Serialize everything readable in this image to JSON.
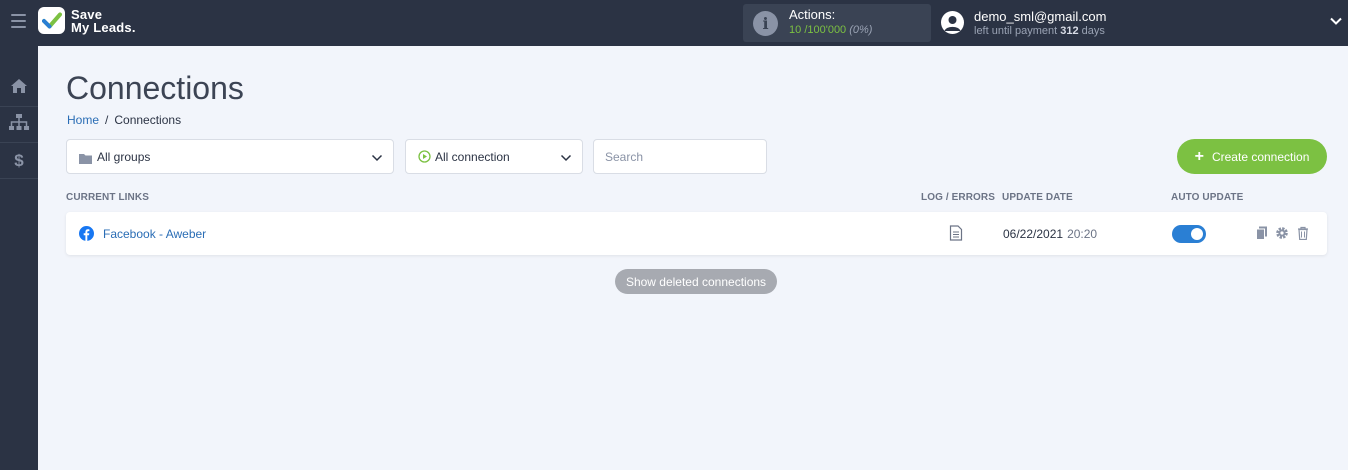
{
  "brand": {
    "line1": "Save",
    "line2": "My Leads."
  },
  "actions": {
    "label": "Actions:",
    "used": "10",
    "total": "/100'000",
    "percent": "(0%)"
  },
  "user": {
    "email": "demo_sml@gmail.com",
    "payment_prefix": "left until payment",
    "days": "312",
    "days_suffix": "days"
  },
  "sidebar": {
    "items": [
      {
        "icon": "home-icon"
      },
      {
        "icon": "sitemap-icon"
      },
      {
        "icon": "dollar-icon"
      }
    ]
  },
  "page": {
    "title": "Connections"
  },
  "breadcrumb": {
    "home": "Home",
    "separator": "/",
    "current": "Connections"
  },
  "filters": {
    "groups": "All groups",
    "connection": "All connection",
    "search_placeholder": "Search"
  },
  "create_button": "Create connection",
  "table": {
    "headers": {
      "links": "CURRENT LINKS",
      "log": "LOG / ERRORS",
      "date": "UPDATE DATE",
      "auto": "AUTO UPDATE"
    },
    "rows": [
      {
        "name": "Facebook - Aweber",
        "date": "06/22/2021",
        "time": "20:20",
        "auto_update": true
      }
    ]
  },
  "show_deleted": "Show deleted connections",
  "colors": {
    "sidebar": "#2b3344",
    "accent_green": "#7cc142",
    "link_blue": "#2a6db5",
    "toggle_blue": "#2a7fd4",
    "background": "#f2f5fb"
  }
}
